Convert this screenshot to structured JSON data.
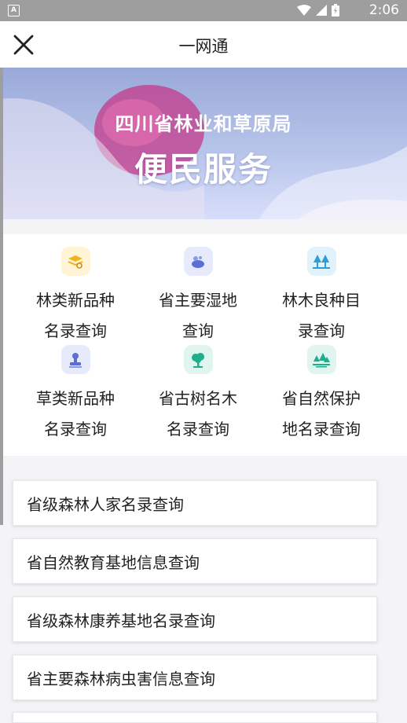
{
  "status_bar": {
    "time": "2:06",
    "left_icon": "A"
  },
  "app_bar": {
    "title": "一网通"
  },
  "banner": {
    "subtitle": "四川省林业和草原局",
    "title": "便民服务"
  },
  "grid": [
    {
      "line1": "林类新品种",
      "line2": "名录查询",
      "icon": "layers-search-icon",
      "icon_bg": "#fff4d6",
      "icon_color": "#f2b21c"
    },
    {
      "line1": "省主要湿地",
      "line2": "查询",
      "icon": "wetland-icon",
      "icon_bg": "#e6eafb",
      "icon_color": "#5a6fd6"
    },
    {
      "line1": "林木良种目",
      "line2": "录查询",
      "icon": "forest-icon",
      "icon_bg": "#e2f2fb",
      "icon_color": "#2a9ed8"
    },
    {
      "line1": "草类新品种",
      "line2": "名录查询",
      "icon": "stamp-icon",
      "icon_bg": "#e6eafb",
      "icon_color": "#5a6fd6"
    },
    {
      "line1": "省古树名木",
      "line2": "名录查询",
      "icon": "ancient-tree-icon",
      "icon_bg": "#e0f5ef",
      "icon_color": "#1fae8a"
    },
    {
      "line1": "省自然保护",
      "line2": "地名录查询",
      "icon": "reserve-icon",
      "icon_bg": "#e0f5ef",
      "icon_color": "#1fae8a"
    }
  ],
  "list": [
    "省级森林人家名录查询",
    "省自然教育基地信息查询",
    "省级森林康养基地名录查询",
    "省主要森林病虫害信息查询"
  ]
}
